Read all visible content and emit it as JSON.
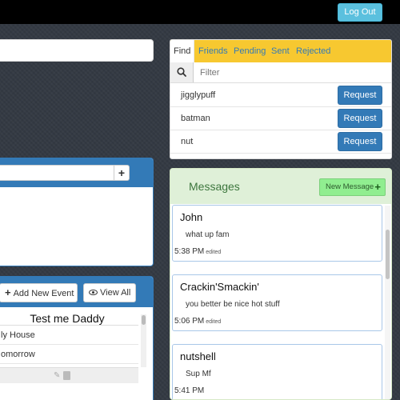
{
  "header": {
    "logout_label": "Log Out"
  },
  "friends": {
    "tabs": [
      "Find",
      "Friends",
      "Pending",
      "Sent",
      "Rejected"
    ],
    "filter_placeholder": "Filter",
    "rows": [
      {
        "name": "jigglypuff",
        "action": "Request"
      },
      {
        "name": "batman",
        "action": "Request"
      },
      {
        "name": "nut",
        "action": "Request"
      }
    ]
  },
  "messages": {
    "title": "Messages",
    "new_message_label": "New Message",
    "items": [
      {
        "author": "John",
        "text": "what up fam",
        "time": "5:38 PM",
        "edited": "edited"
      },
      {
        "author": "Crackin'Smackin'",
        "text": "you better be nice hot stuff",
        "time": "5:06 PM",
        "edited": "edited"
      },
      {
        "author": "nutshell",
        "text": "Sup Mf",
        "time": "5:41 PM",
        "edited": ""
      }
    ]
  },
  "events": {
    "add_label": "Add New Event",
    "view_all_label": "View All",
    "title": "Test me Daddy",
    "rows": [
      "ly House",
      "omorrow"
    ]
  },
  "colors": {
    "navbar": "#000000",
    "primary": "#337ab7",
    "info": "#5bc0de",
    "tab_bar": "#f7c830",
    "messages_bg": "#dff0d8",
    "new_message_btn": "#90ee90"
  },
  "icons": {
    "filter": "search-icon",
    "add": "plus-icon",
    "view_all": "eye-icon",
    "edit": "pencil-icon",
    "delete": "trash-icon"
  }
}
